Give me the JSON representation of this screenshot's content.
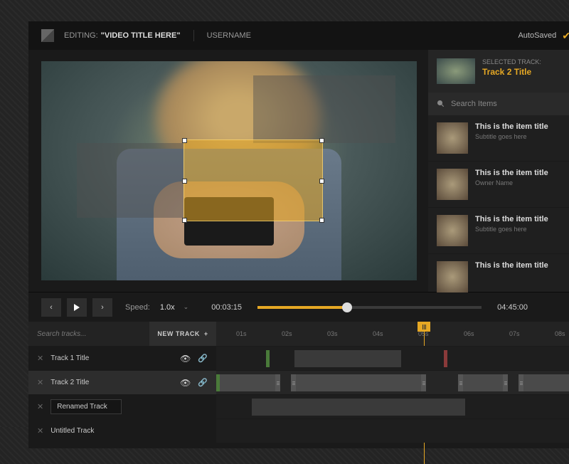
{
  "topbar": {
    "editing_label": "EDITING:",
    "video_title": "\"VIDEO TITLE HERE\"",
    "username": "USERNAME",
    "autosaved": "AutoSaved"
  },
  "sidebar": {
    "selected_label": "SELECTED TRACK:",
    "selected_title": "Track 2 Title",
    "search_placeholder": "Search Items",
    "items": [
      {
        "title": "This is the item title",
        "subtitle": "Subtitle goes here"
      },
      {
        "title": "This is the item title",
        "owner": "Owner Name"
      },
      {
        "title": "This is the item title",
        "subtitle": "Subtitle goes here"
      },
      {
        "title": "This is the item title"
      }
    ]
  },
  "controls": {
    "speed_label": "Speed:",
    "speed_value": "1.0x",
    "current_time": "00:03:15",
    "duration": "04:45:00"
  },
  "track_header": {
    "search_placeholder": "Search tracks...",
    "new_track": "NEW TRACK"
  },
  "ruler": {
    "ticks": [
      "01s",
      "02s",
      "03s",
      "04s",
      "05s",
      "06s",
      "07s",
      "08s"
    ]
  },
  "tracks": [
    {
      "name": "Track 1 Title"
    },
    {
      "name": "Track 2 Title"
    },
    {
      "name": "Renamed Track"
    },
    {
      "name": "Untitled Track"
    }
  ]
}
